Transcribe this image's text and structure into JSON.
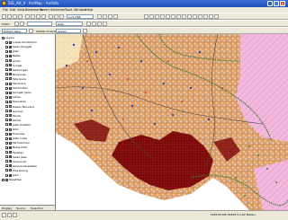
{
  "window": {
    "title": "SIG_AH_II - ArcMap - ArcInfo"
  },
  "menu": [
    "File",
    "Edit",
    "View",
    "Bookmarks",
    "Insert",
    "Selection",
    "Tools",
    "Window",
    "Help"
  ],
  "toolbar1": {
    "scale": "1:71,748"
  },
  "toolbar2": {
    "editor_label": "Editor",
    "target": "Kota"
  },
  "toolbar3": {
    "left_combo": "Extract Aspe",
    "right_combo": "Layers",
    "spatial_label": "Spatial Analyst"
  },
  "toc": {
    "layers": [
      {
        "label": "Layers",
        "level": 0,
        "expanded": true
      },
      {
        "label": "Lokasi Pendidikan",
        "level": 1,
        "checked": true,
        "swatch": "#5566cc"
      },
      {
        "label": "Kelas Tanggak",
        "level": 1,
        "checked": true,
        "swatch": "#dd3333"
      },
      {
        "label": "Jalan",
        "level": 1,
        "checked": true,
        "swatch": "#88aa44"
      },
      {
        "label": "Batas",
        "level": 1,
        "checked": true,
        "swatch": "#333333"
      },
      {
        "label": "Aliran",
        "level": 1,
        "checked": true,
        "swatch": "#4488dd"
      },
      {
        "label": "Sungai",
        "level": 1,
        "checked": true,
        "swatch": "#4477cc"
      },
      {
        "label": "Kemiringan",
        "level": 1,
        "checked": true,
        "swatch": "#aa9955"
      },
      {
        "label": "Bangunan",
        "level": 1,
        "checked": true,
        "swatch": "#884444"
      },
      {
        "label": "Tata Guna",
        "level": 1,
        "checked": true,
        "swatch": "#bbaa66"
      },
      {
        "label": "Penduduk",
        "level": 1,
        "checked": true,
        "swatch": "#cc8844"
      },
      {
        "label": "Kecamatan",
        "level": 1,
        "checked": true,
        "swatch": "#996633"
      },
      {
        "label": "Jaringan Jalan",
        "level": 1,
        "checked": true,
        "swatch": "#777777"
      },
      {
        "label": "Lahan",
        "level": 1,
        "checked": true,
        "swatch": "#cc9977"
      },
      {
        "label": "Kelurahan",
        "level": 1,
        "checked": true,
        "swatch": "#ccbb88"
      },
      {
        "label": "Rawan Bencana",
        "level": 1,
        "checked": true,
        "swatch": "#ee99cc"
      },
      {
        "label": "Geologi",
        "level": 1,
        "checked": true,
        "swatch": "#aa88cc"
      },
      {
        "label": "Tanah",
        "level": 1,
        "checked": true,
        "swatch": "#bb6644"
      },
      {
        "label": "Pantai",
        "level": 1,
        "checked": true,
        "swatch": "#5599bb"
      },
      {
        "label": "Jalan Kolektor",
        "level": 1,
        "checked": true,
        "swatch": "#555555"
      },
      {
        "label": "Iklim",
        "level": 1,
        "checked": true,
        "swatch": "#99bbdd"
      },
      {
        "label": "Drainase",
        "level": 1,
        "checked": true,
        "swatch": "#3366aa"
      },
      {
        "label": "Jalan Lokal",
        "level": 1,
        "checked": true,
        "swatch": "#888888"
      },
      {
        "label": "Permukiman",
        "level": 1,
        "checked": true,
        "swatch": "#dd8866"
      },
      {
        "label": "Batas Kota",
        "level": 1,
        "checked": true,
        "swatch": "#222222"
      },
      {
        "label": "Fasilitas",
        "level": 1,
        "checked": true,
        "swatch": "#8855aa"
      },
      {
        "label": "Kelas Jalan",
        "level": 1,
        "checked": true,
        "swatch": "#664422"
      },
      {
        "label": "Sarana Air",
        "level": 1,
        "checked": true,
        "swatch": "#3399cc"
      },
      {
        "label": "Sarana Kesehatan",
        "level": 1,
        "checked": true,
        "swatch": "#cc3333"
      },
      {
        "label": "Pola Ruang",
        "level": 1,
        "checked": true,
        "swatch": "#bb88bb"
      },
      {
        "label": "Jalur",
        "level": 1,
        "checked": true,
        "swatch": "#444444"
      },
      {
        "label": "BaseMap",
        "level": 0,
        "checked": true,
        "swatch": "#999999"
      }
    ],
    "tabs": [
      "Display",
      "Source",
      "Selection"
    ]
  },
  "status": {
    "coords": "249978.096  9246574.162 Meters"
  },
  "colors": {
    "titlebar": "#1f4fb8",
    "map_orange": "#e6a46a",
    "map_pink": "#f3b8de",
    "settlement": "#7a0d0d",
    "road_green": "#3f7a3a",
    "blue_point": "#3344aa"
  }
}
